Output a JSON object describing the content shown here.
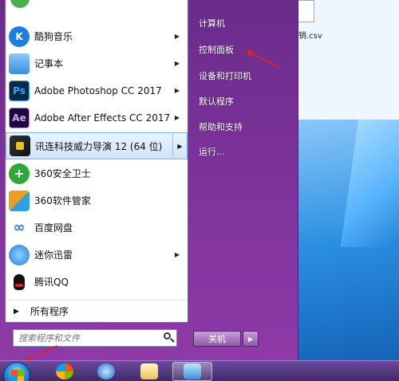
{
  "desktop": {
    "file_label": "销.csv"
  },
  "start_menu": {
    "programs": [
      {
        "label": "酷狗音乐",
        "icon": "kugou-icon",
        "icon_text": "K",
        "icon_color": "#1b7fe0",
        "has_arrow": true
      },
      {
        "label": "记事本",
        "icon": "notepad-icon",
        "icon_text": "",
        "icon_color": "#3b8fd8",
        "has_arrow": true
      },
      {
        "label": "Adobe Photoshop CC 2017",
        "icon": "photoshop-icon",
        "icon_text": "Ps",
        "icon_color": "#0b2a4a",
        "has_arrow": true
      },
      {
        "label": "Adobe After Effects CC 2017",
        "icon": "after-effects-icon",
        "icon_text": "Ae",
        "icon_color": "#1a0a3a",
        "has_arrow": true
      },
      {
        "label": "讯连科技威力导演 12 (64 位)",
        "icon": "powerdirector-icon",
        "icon_text": "",
        "icon_color": "#2a2a2a",
        "has_arrow": true,
        "highlight": true
      },
      {
        "label": "360安全卫士",
        "icon": "360-security-icon",
        "icon_text": "+",
        "icon_color": "#2fa83a",
        "has_arrow": false
      },
      {
        "label": "360软件管家",
        "icon": "360-software-icon",
        "icon_text": "",
        "icon_color": "#e8a020",
        "has_arrow": false
      },
      {
        "label": "百度网盘",
        "icon": "baidu-netdisk-icon",
        "icon_text": "∞",
        "icon_color": "#2c7be5",
        "has_arrow": false
      },
      {
        "label": "迷你迅雷",
        "icon": "xunlei-icon",
        "icon_text": "",
        "icon_color": "#1e7fd8",
        "has_arrow": true
      },
      {
        "label": "腾讯QQ",
        "icon": "qq-icon",
        "icon_text": "",
        "icon_color": "#111111",
        "has_arrow": false
      }
    ],
    "all_programs": "所有程序",
    "search_placeholder": "搜索程序和文件",
    "right_items": [
      "计算机",
      "控制面板",
      "设备和打印机",
      "默认程序",
      "帮助和支持",
      "运行..."
    ],
    "shutdown_label": "关机",
    "accent": "#e0202a"
  }
}
